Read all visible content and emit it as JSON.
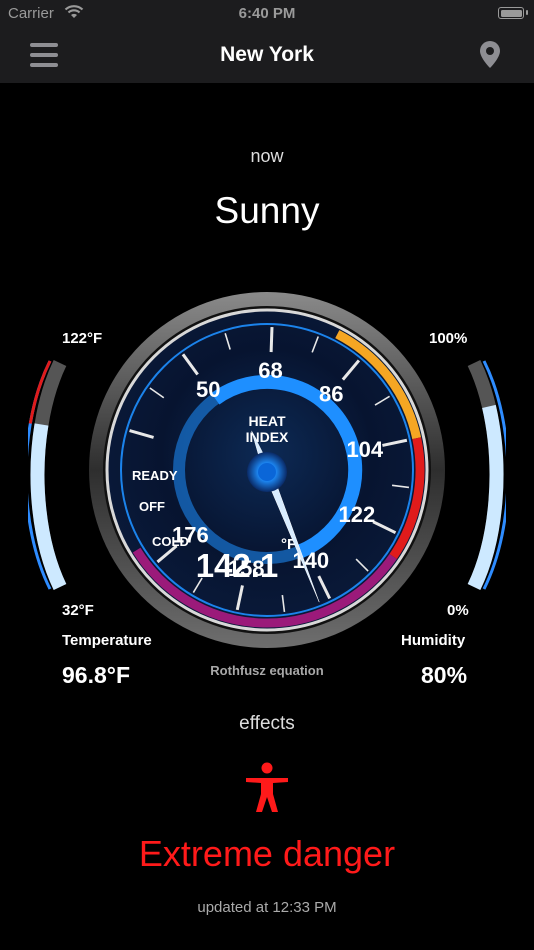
{
  "status_bar": {
    "carrier": "Carrier",
    "time": "6:40 PM"
  },
  "nav": {
    "title": "New York"
  },
  "period": "now",
  "condition": "Sunny",
  "temperature": {
    "max_label": "122°F",
    "min_label": "32°F",
    "title": "Temperature",
    "value": "96.8°F",
    "fill_fraction": 0.72
  },
  "humidity": {
    "max_label": "100%",
    "min_label": "0%",
    "title": "Humidity",
    "value": "80%",
    "fill_fraction": 0.8
  },
  "gauge": {
    "title_line1": "HEAT",
    "title_line2": "INDEX",
    "unit": "°F",
    "value": "142.1",
    "reading": 142.1,
    "ticks": [
      "50",
      "68",
      "86",
      "104",
      "122",
      "140",
      "158",
      "176"
    ],
    "states": [
      "READY",
      "OFF",
      "COLD"
    ],
    "colors": {
      "caution": "#f5a623",
      "danger": "#e01b1b",
      "extreme": "#9b1a7a",
      "ring": "#1e8fff"
    }
  },
  "equation": "Rothfusz equation",
  "effects_label": "effects",
  "effect_icon": "person-icon",
  "danger_level": "Extreme danger",
  "updated": "updated at 12:33 PM"
}
